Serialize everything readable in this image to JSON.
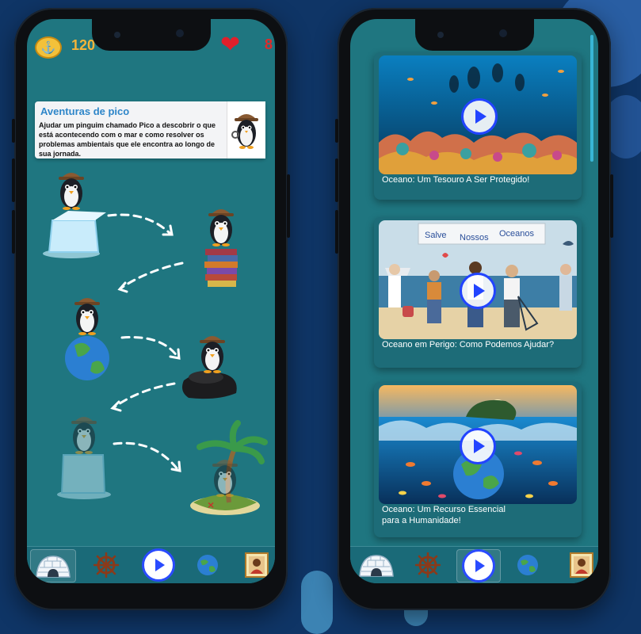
{
  "colors": {
    "background": "#0f3566",
    "screen": "#1f7680",
    "accent_gold": "#f3b43a",
    "heart_red": "#e0202b",
    "play_blue": "#2a4bff"
  },
  "left_screen": {
    "status": {
      "coins_icon": "anchor-icon",
      "coins": "120",
      "lives_icon": "heart-icon",
      "lives": "8"
    },
    "story_card": {
      "title": "Aventuras de pico",
      "description": "Ajudar um pinguim chamado Pico a descobrir o que está acontecendo com o mar e como resolver os problemas ambientais que ele encontra ao longo de sua jornada.",
      "thumbnail_icon": "penguin-explorer-icon"
    },
    "path_nodes": [
      {
        "name": "penguin-on-ice",
        "icon": "ice-cube-icon",
        "locked": false
      },
      {
        "name": "penguin-on-books",
        "icon": "books-icon",
        "locked": false
      },
      {
        "name": "penguin-on-earth",
        "icon": "earth-icon",
        "locked": false
      },
      {
        "name": "penguin-on-oil",
        "icon": "oil-spill-icon",
        "locked": false
      },
      {
        "name": "penguin-on-ice-locked",
        "icon": "ice-cube-icon",
        "locked": true
      },
      {
        "name": "penguin-on-island-locked",
        "icon": "island-icon",
        "locked": true
      }
    ]
  },
  "right_screen": {
    "videos": [
      {
        "title": "Oceano: Um Tesouro A Ser Protegido!"
      },
      {
        "title": "Oceano em Perigo: Como Podemos Ajudar?",
        "banner_words": [
          "Salve",
          "Nossos",
          "Oceanos"
        ]
      },
      {
        "title_line1": "Oceano: Um Recurso Essencial",
        "title_line2": "para a Humanidade!"
      }
    ]
  },
  "navbar": {
    "items": [
      "igloo-icon",
      "ship-wheel-icon",
      "play-icon",
      "globe-icon",
      "profile-icon"
    ]
  }
}
